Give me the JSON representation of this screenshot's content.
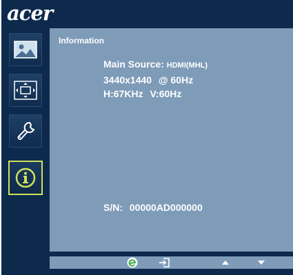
{
  "brand": {
    "logo_text": "acer"
  },
  "sidebar": {
    "items": [
      {
        "name": "picture",
        "icon": "picture-icon"
      },
      {
        "name": "display",
        "icon": "screen-position-icon"
      },
      {
        "name": "settings",
        "icon": "wrench-icon"
      },
      {
        "name": "information",
        "icon": "info-icon",
        "selected": true
      }
    ]
  },
  "panel": {
    "title": "Information",
    "main_source_label": "Main Source:",
    "main_source_value": "HDMI(MHL)",
    "resolution": "3440x1440",
    "refresh": "@ 60Hz",
    "h_freq": "H:67KHz",
    "v_freq": "V:60Hz",
    "serial_label": "S/N:",
    "serial_value": "00000AD000000"
  },
  "bottom_bar": {
    "buttons": [
      {
        "icon": "acer-e-icon"
      },
      {
        "icon": "exit-icon"
      },
      {
        "icon": "up-arrow-icon"
      },
      {
        "icon": "down-arrow-icon"
      }
    ]
  },
  "colors": {
    "background": "#0d2a4d",
    "panel": "#7e9bb8",
    "selected_border": "#cfe25a",
    "e_icon": "#4caf50"
  }
}
